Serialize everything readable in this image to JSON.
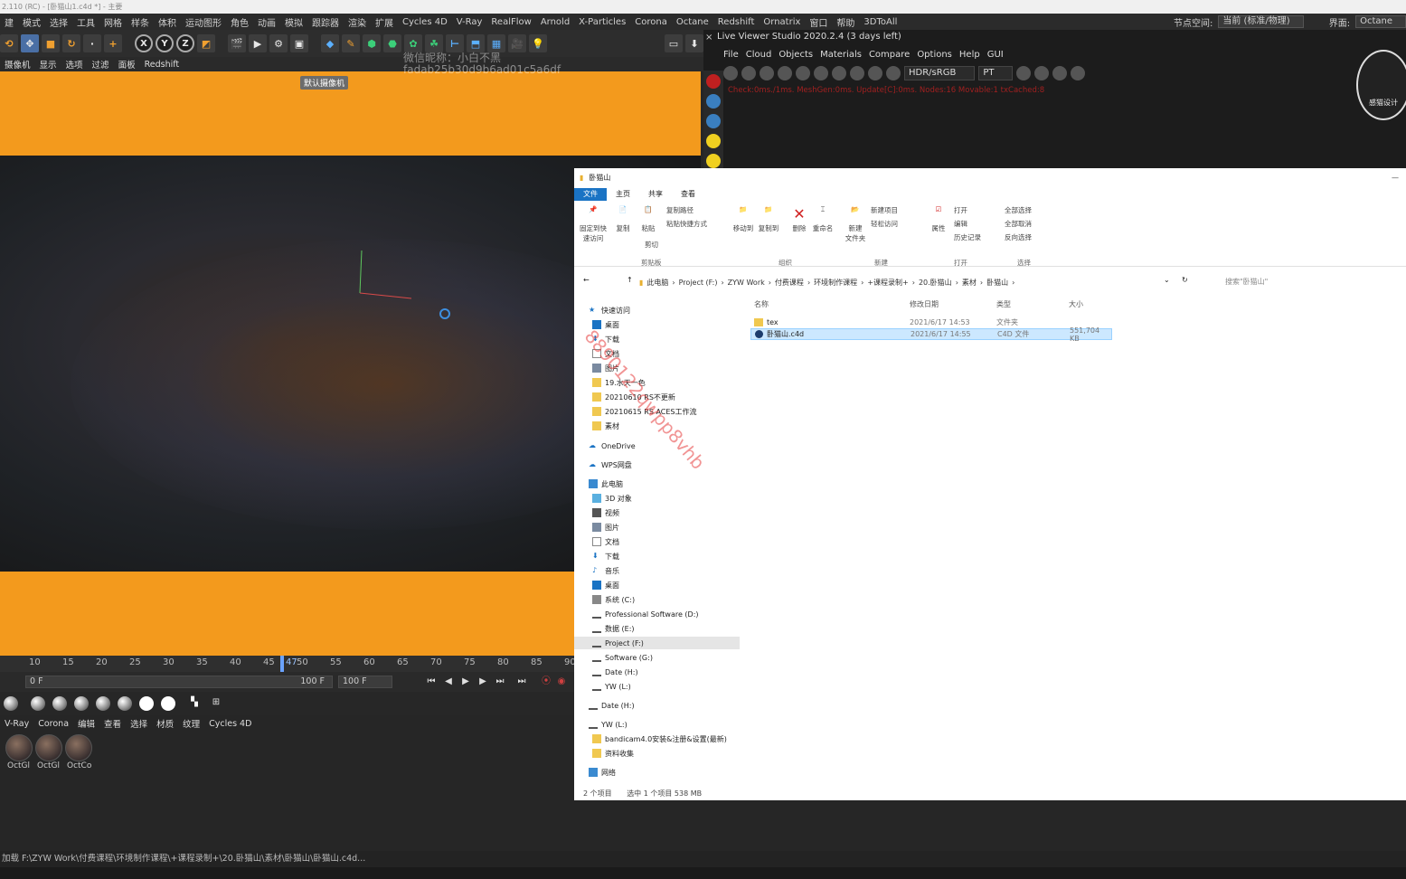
{
  "window": {
    "title": "2.110 (RC) - [卧猫山1.c4d *] - 主要"
  },
  "menubar": {
    "items": [
      "建",
      "模式",
      "选择",
      "工具",
      "网格",
      "样条",
      "体积",
      "运动图形",
      "角色",
      "动画",
      "模拟",
      "跟踪器",
      "渲染",
      "扩展",
      "Cycles 4D",
      "V-Ray",
      "RealFlow",
      "Arnold",
      "X-Particles",
      "Corona",
      "Octane",
      "Redshift",
      "Ornatrix",
      "窗口",
      "帮助",
      "3DToAll"
    ],
    "node_space_label": "节点空间:",
    "node_space_value": "当前 (标准/物理)",
    "layout_label": "界面:",
    "layout_value": "Octane"
  },
  "viewport": {
    "menu": [
      "摄像机",
      "显示",
      "选项",
      "过滤",
      "面板",
      "Redshift"
    ],
    "camera_tag": "默认摄像机",
    "watermark_line1": "微信昵称：小白不黑",
    "watermark_line2": "fadab25b30d9b6ad01c5a6df"
  },
  "diagonal_watermark": "8890122qwpp8vhb",
  "timeline": {
    "ticks": [
      "10",
      "15",
      "20",
      "25",
      "30",
      "35",
      "40",
      "45",
      "50",
      "55",
      "60",
      "65",
      "70",
      "75",
      "80",
      "85",
      "90"
    ],
    "current_frame": "47",
    "start_frame": "0 F",
    "end_frame": "100 F",
    "end_frame2": "100 F"
  },
  "material_menu": [
    "V-Ray",
    "Corona",
    "编辑",
    "查看",
    "选择",
    "材质",
    "纹理",
    "Cycles 4D"
  ],
  "materials": [
    "OctGl",
    "OctGl",
    "OctCo"
  ],
  "status_text": "加载 F:\\ZYW Work\\付费课程\\环境制作课程\\+课程录制+\\20.卧猫山\\素材\\卧猫山\\卧猫山.c4d...",
  "live_viewer": {
    "title": "Live Viewer Studio 2020.2.4 (3 days left)",
    "menu": [
      "File",
      "Cloud",
      "Objects",
      "Materials",
      "Compare",
      "Options",
      "Help",
      "GUI"
    ],
    "color_space": "HDR/sRGB",
    "kernel": "PT",
    "info": "Check:0ms./1ms. MeshGen:0ms. Update[C]:0ms. Nodes:16 Movable:1 txCached:8",
    "logo_text": "感猫设计"
  },
  "explorer": {
    "title": "卧猫山",
    "tabs": [
      "文件",
      "主页",
      "共享",
      "查看"
    ],
    "ribbon": {
      "pin": "固定到快\n速访问",
      "copy": "复制",
      "paste": "粘贴",
      "copy_path": "复制路径",
      "paste_shortcut": "粘贴快捷方式",
      "cut": "剪切",
      "move_to": "移动到",
      "copy_to": "复制到",
      "delete": "删除",
      "rename": "重命名",
      "new_folder": "新建\n文件夹",
      "new_item": "新建项目",
      "easy_access": "轻松访问",
      "properties": "属性",
      "open": "打开",
      "edit": "编辑",
      "history": "历史记录",
      "select_all": "全部选择",
      "select_none": "全部取消",
      "invert": "反向选择",
      "groups": [
        "剪贴板",
        "组织",
        "新建",
        "打开",
        "选择"
      ]
    },
    "breadcrumbs": [
      "此电脑",
      "Project (F:)",
      "ZYW Work",
      "付费课程",
      "环境制作课程",
      "+课程录制+",
      "20.卧猫山",
      "素材",
      "卧猫山"
    ],
    "search_placeholder": "搜索\"卧猫山\"",
    "nav": [
      {
        "label": "快速访问"
      },
      {
        "label": "桌面"
      },
      {
        "label": "下载"
      },
      {
        "label": "文档"
      },
      {
        "label": "图片"
      },
      {
        "label": "19.水天一色"
      },
      {
        "label": "20210610 RS不更新"
      },
      {
        "label": "20210615 RS ACES工作流"
      },
      {
        "label": "素材"
      },
      {
        "label": "OneDrive"
      },
      {
        "label": "WPS网盘"
      },
      {
        "label": "此电脑"
      },
      {
        "label": "3D 对象"
      },
      {
        "label": "视频"
      },
      {
        "label": "图片"
      },
      {
        "label": "文档"
      },
      {
        "label": "下载"
      },
      {
        "label": "音乐"
      },
      {
        "label": "桌面"
      },
      {
        "label": "系统 (C:)"
      },
      {
        "label": "Professional Software (D:)"
      },
      {
        "label": "数据 (E:)"
      },
      {
        "label": "Project (F:)"
      },
      {
        "label": "Software (G:)"
      },
      {
        "label": "Date (H:)"
      },
      {
        "label": "YW (L:)"
      },
      {
        "label": "Date (H:)"
      },
      {
        "label": "YW (L:)"
      },
      {
        "label": "bandicam4.0安装&注册&设置(最新)"
      },
      {
        "label": "资料收集"
      },
      {
        "label": "网络"
      }
    ],
    "columns": [
      "名称",
      "修改日期",
      "类型",
      "大小"
    ],
    "files": [
      {
        "name": "tex",
        "date": "2021/6/17 14:53",
        "type": "文件夹",
        "size": ""
      },
      {
        "name": "卧猫山.c4d",
        "date": "2021/6/17 14:55",
        "type": "C4D 文件",
        "size": "551,704 KB"
      }
    ],
    "status": {
      "items": "2 个项目",
      "selected": "选中 1 个项目  538 MB"
    }
  }
}
